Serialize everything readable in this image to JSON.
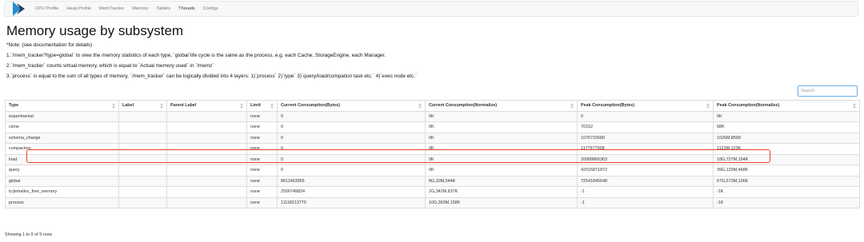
{
  "nav": {
    "items": [
      {
        "label": "CPU Profile",
        "active": false
      },
      {
        "label": "Heap Profile",
        "active": false
      },
      {
        "label": "MemTracker",
        "active": false
      },
      {
        "label": "Memory",
        "active": false
      },
      {
        "label": "Tablets",
        "active": false
      },
      {
        "label": "Threads",
        "active": true
      },
      {
        "label": "Configs",
        "active": false
      }
    ]
  },
  "page": {
    "title": "Memory usage by subsystem",
    "notes": [
      "*Note: (see documentation for details)",
      "1.`/mem_tracker?type=global` to view the memory statistics of each type, `global`life cycle is the same as the process, e.g. each Cache, StorageEngine, each Manager.",
      "2.`/mem_tracker` counts virtual memory, which is equal to `Actual memory used` in `/memz`",
      "3.`process` is equal to the sum of all types of memory, `/mem_tracker` can be logically divided into 4 layers: 1)`process` 2)`type` 3)`query/load/compation task etc.` 4)`exec node etc.`"
    ]
  },
  "search": {
    "placeholder": "Search"
  },
  "table": {
    "columns": [
      "Type",
      "Label",
      "Parent Label",
      "Limit",
      "Current Consumption(Bytes)",
      "Current Consumption(Normalize)",
      "Peak Consumption(Bytes)",
      "Peak Consumption(Normalize)"
    ],
    "rows": [
      [
        "experimental",
        "",
        "",
        "none",
        "0",
        "0K",
        "0",
        "0K"
      ],
      [
        "clone",
        "",
        "",
        "none",
        "0",
        "0K",
        "70152",
        "68K"
      ],
      [
        "schema_change",
        "",
        "",
        "none",
        "0",
        "0K",
        "1076715680",
        "1026M,856K"
      ],
      [
        "compaction",
        "",
        "",
        "none",
        "0",
        "0K",
        "1177677008",
        "1123M,123K"
      ],
      [
        "load",
        "",
        "",
        "none",
        "0",
        "0K",
        "20089866363",
        "18G,727M,194K"
      ],
      [
        "query",
        "",
        "",
        "none",
        "0",
        "0K",
        "42015871872",
        "39G,133M,468K"
      ],
      [
        "global",
        "",
        "",
        "none",
        "8611463955",
        "8G,20M,544K",
        "72541845648",
        "67G,573M,106K"
      ],
      [
        "tc/jemalloc_free_memory",
        "",
        "",
        "none",
        "2506749824",
        "2G,342M,637K",
        "-1",
        "-1K"
      ],
      [
        "process",
        "",
        "",
        "none",
        "11118213779",
        "10G,363M,158K",
        "-1",
        "-1K"
      ]
    ],
    "highlighted_row": "compaction"
  },
  "footer": {
    "text": "Showing 1 to 9 of 9 rows"
  },
  "colors": {
    "highlight": "#e2442b",
    "search_border": "#66afe9",
    "logo_primary": "#1f8fcf",
    "logo_secondary": "#2a3d66"
  }
}
